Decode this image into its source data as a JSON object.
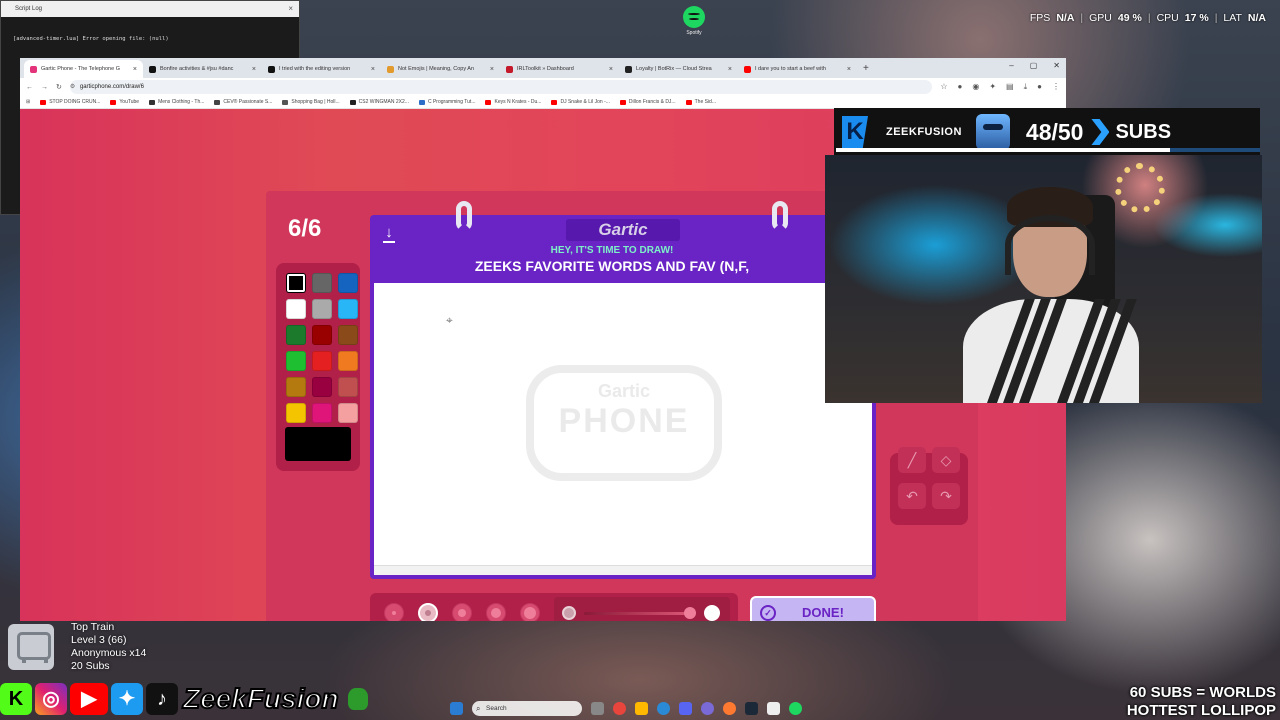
{
  "system_stats": {
    "fps_label": "FPS",
    "fps_value": "N/A",
    "gpu_label": "GPU",
    "gpu_value": "49 %",
    "cpu_label": "CPU",
    "cpu_value": "17 %",
    "lat_label": "LAT",
    "lat_value": "N/A"
  },
  "script_log": {
    "title": "Script Log",
    "line": "[advanced-timer.lua] Error opening file: (null)"
  },
  "desktop_icon": {
    "label": "Spotify"
  },
  "browser": {
    "tabs": [
      {
        "label": "Gartic Phone - The Telephone G",
        "color": "#e3337a"
      },
      {
        "label": "Bonfire activities & #jsu #danc",
        "color": "#111111"
      },
      {
        "label": "I tried with the editing version",
        "color": "#111111"
      },
      {
        "label": "Not Emojis | Meaning, Copy An",
        "color": "#e39a2d"
      },
      {
        "label": "IRLToolkit » Dashboard",
        "color": "#c3192a"
      },
      {
        "label": "Loyalty | BotRix — Cloud Strea",
        "color": "#222222"
      },
      {
        "label": "I dare you to start a beef with",
        "color": "#ff0000"
      }
    ],
    "url": "garticphone.com/draw/6",
    "bookmarks": [
      {
        "label": "STOP DOING CRUN...",
        "color": "#ff0000"
      },
      {
        "label": "YouTube",
        "color": "#ff0000"
      },
      {
        "label": "Mens Clothing - Th...",
        "color": "#333333"
      },
      {
        "label": "CEV® Passionate S...",
        "color": "#444444"
      },
      {
        "label": "Shopping Bag | Holl...",
        "color": "#555555"
      },
      {
        "label": "CS2 WINGMAN 2X2...",
        "color": "#222222"
      },
      {
        "label": "C Programming Tut...",
        "color": "#2d6ec9"
      },
      {
        "label": "Keys N Krates - Du...",
        "color": "#ff0000"
      },
      {
        "label": "DJ Snake & Lil Jon -...",
        "color": "#ff0000"
      },
      {
        "label": "Dillon Francis & DJ...",
        "color": "#ff0000"
      },
      {
        "label": "The Sid...",
        "color": "#ff0000"
      }
    ]
  },
  "game": {
    "round": "6/6",
    "logo": "Gartic",
    "hint": "HEY, IT'S TIME TO DRAW!",
    "prompt": "ZEEKS FAVORITE WORDS AND FAV (N,F,",
    "watermark_top": "Gartic",
    "watermark_bottom": "PHONE",
    "palette": [
      "#000000",
      "#666666",
      "#1565c0",
      "#ffffff",
      "#aaaaaa",
      "#29b6f6",
      "#1b7a2c",
      "#990000",
      "#8a4a1a",
      "#1ec032",
      "#e52020",
      "#f07a20",
      "#b47a10",
      "#990040",
      "#c05050",
      "#f5c400",
      "#e0157a",
      "#f5a0a0"
    ],
    "current_color": "#000000",
    "brush_sizes": [
      1,
      2,
      3,
      4,
      5
    ],
    "selected_brush": 2,
    "opacity_percent": 100,
    "done_label": "DONE!"
  },
  "sub_goal": {
    "initial": "K",
    "name": "ZEEKFUSION",
    "count": "48/50",
    "label": "SUBS",
    "progress": 0.96
  },
  "top_train": {
    "title": "Top Train",
    "level": "Level 3  (66)",
    "user": "Anonymous x14",
    "subs": "20 Subs"
  },
  "social": {
    "handle": "ZeekFusion"
  },
  "goal_text": {
    "line1": "60 SUBS = WORLDS",
    "line2": "HOTTEST LOLLIPOP"
  },
  "taskbar": {
    "search_placeholder": "Search"
  }
}
